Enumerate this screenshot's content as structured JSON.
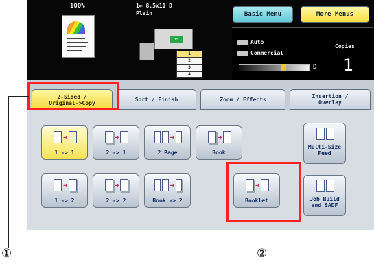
{
  "status": {
    "zoom": "100%",
    "paper_size": "1← 8.5x11 D",
    "paper_type": "Plain",
    "trays": [
      "1",
      "2",
      "3",
      "4"
    ],
    "basic_menu_label": "Basic Menu",
    "more_menus_label": "More Menus",
    "mode_auto": "Auto",
    "mode_commercial": "Commercial",
    "copies_label": "Copies",
    "copies_value": "1",
    "density_end": "D"
  },
  "tabs": [
    {
      "line1": "2-Sided /",
      "line2": "Original->Copy"
    },
    {
      "line1": "Sort / Finish",
      "line2": ""
    },
    {
      "line1": "Zoom / Effects",
      "line2": ""
    },
    {
      "line1": "Insertion /",
      "line2": "Overlay"
    }
  ],
  "functions": [
    {
      "label": "1 -> 1"
    },
    {
      "label": "2 -> 1"
    },
    {
      "label": "2 Page"
    },
    {
      "label": "Book"
    },
    {
      "label": "Multi-Size",
      "label2": "Feed"
    },
    {
      "label": "1 -> 2"
    },
    {
      "label": "2 -> 2"
    },
    {
      "label": "Book -> 2"
    },
    {
      "label": "Booklet"
    },
    {
      "label": "Job Build",
      "label2": "and SADF"
    }
  ],
  "callouts": [
    "①",
    "②"
  ],
  "colors": {
    "highlight": "#ff2020",
    "selected_tab": "#f2d93b"
  }
}
